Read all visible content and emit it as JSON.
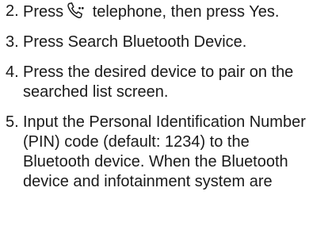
{
  "steps": [
    {
      "number": "2.",
      "text_before_icon": "Press",
      "icon": "telephone-icon",
      "text_after_icon": "telephone, then press Yes."
    },
    {
      "number": "3.",
      "text": "Press Search Bluetooth Device."
    },
    {
      "number": "4.",
      "text": "Press the desired device to pair on the searched list screen."
    },
    {
      "number": "5.",
      "text": "Input the Personal Identification Number (PIN) code (default: 1234) to the Bluetooth device. When the Bluetooth device and infotainment system are"
    }
  ]
}
